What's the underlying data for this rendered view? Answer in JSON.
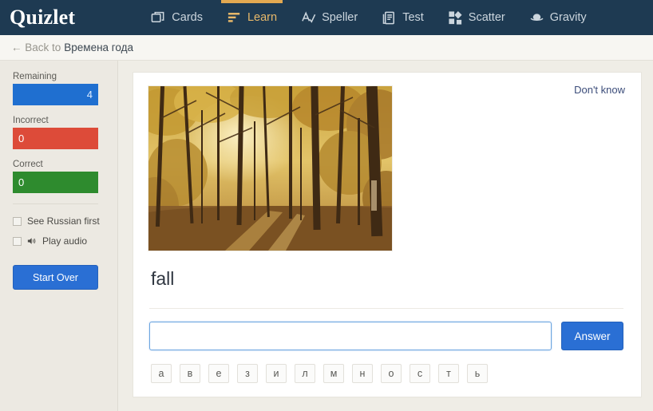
{
  "header": {
    "logo": "Quizlet",
    "nav": [
      {
        "label": "Cards",
        "icon": "cards-icon",
        "active": false
      },
      {
        "label": "Learn",
        "icon": "learn-icon",
        "active": true
      },
      {
        "label": "Speller",
        "icon": "speller-icon",
        "active": false
      },
      {
        "label": "Test",
        "icon": "test-icon",
        "active": false
      },
      {
        "label": "Scatter",
        "icon": "scatter-icon",
        "active": false
      },
      {
        "label": "Gravity",
        "icon": "gravity-icon",
        "active": false
      }
    ],
    "bg_color": "#1e3a52",
    "active_color": "#e8b96a"
  },
  "breadcrumb": {
    "back_label": "← Back to",
    "set_title": "Времена года"
  },
  "sidebar": {
    "stats": [
      {
        "label": "Remaining",
        "value": "4",
        "color": "#1f6fd0",
        "align": "right"
      },
      {
        "label": "Incorrect",
        "value": "0",
        "color": "#dd4b39",
        "align": "left"
      },
      {
        "label": "Correct",
        "value": "0",
        "color": "#2e8b2e",
        "align": "left"
      }
    ],
    "options": [
      {
        "label": "See Russian first",
        "checked": false,
        "icon": null
      },
      {
        "label": "Play audio",
        "checked": false,
        "icon": "speaker-icon"
      }
    ],
    "start_over_label": "Start Over"
  },
  "main": {
    "dont_know_label": "Don't know",
    "image_alt": "autumn-forest-photo",
    "term": "fall",
    "answer_placeholder": "",
    "answer_value": "",
    "answer_button_label": "Answer",
    "special_chars": [
      "а",
      "в",
      "е",
      "з",
      "и",
      "л",
      "м",
      "н",
      "о",
      "с",
      "т",
      "ь"
    ]
  }
}
